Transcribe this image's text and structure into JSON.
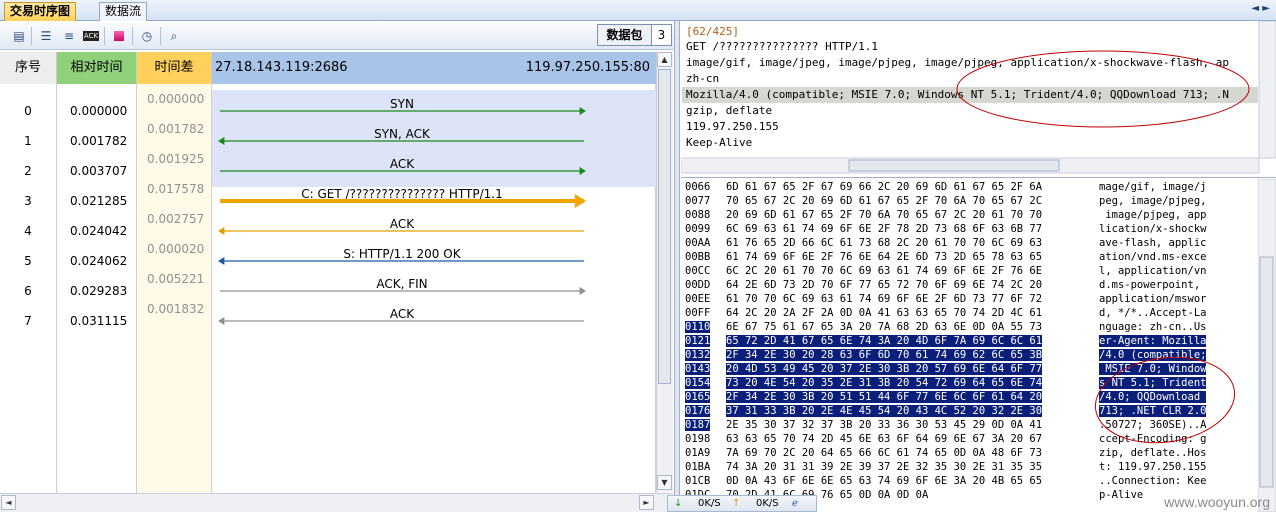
{
  "tabs": [
    {
      "label": "交易时序图"
    },
    {
      "label": "数据流"
    }
  ],
  "nav": {
    "left": "◄",
    "right": "►"
  },
  "toolbar": {
    "packet_label": "数据包",
    "packet_count": "3"
  },
  "columns": {
    "seq": "序号",
    "reltime": "相对时间",
    "delta": "时间差",
    "src": "27.18.143.119:2686",
    "dst": "119.97.250.155:80"
  },
  "rows": [
    {
      "seq": "0",
      "rel": "0.000000",
      "delta": "0.000000",
      "label": "SYN",
      "dir": "right",
      "color": "#1d8a1d"
    },
    {
      "seq": "1",
      "rel": "0.001782",
      "delta": "0.001782",
      "label": "SYN, ACK",
      "dir": "left",
      "color": "#1d8a1d"
    },
    {
      "seq": "2",
      "rel": "0.003707",
      "delta": "0.001925",
      "label": "ACK",
      "dir": "right",
      "color": "#1d8a1d"
    },
    {
      "seq": "3",
      "rel": "0.021285",
      "delta": "0.017578",
      "label": "C: GET /??????????????? HTTP/1.1",
      "dir": "right",
      "color": "#f0a500"
    },
    {
      "seq": "4",
      "rel": "0.024042",
      "delta": "0.002757",
      "label": "ACK",
      "dir": "left",
      "color": "#e0a000"
    },
    {
      "seq": "5",
      "rel": "0.024062",
      "delta": "0.000020",
      "label": "S: HTTP/1.1 200 OK",
      "dir": "left",
      "color": "#1f5aa8"
    },
    {
      "seq": "6",
      "rel": "0.029283",
      "delta": "0.005221",
      "label": "ACK, FIN",
      "dir": "right",
      "color": "#909090"
    },
    {
      "seq": "7",
      "rel": "0.031115",
      "delta": "0.001832",
      "label": "ACK",
      "dir": "left",
      "color": "#909090"
    }
  ],
  "request": {
    "counter": "[62/425]",
    "lines": [
      "GET /??????????????? HTTP/1.1",
      "image/gif, image/jpeg, image/pjpeg, image/pjpeg, application/x-shockwave-flash, ap",
      "zh-cn",
      "Mozilla/4.0 (compatible; MSIE 7.0; Windows NT 5.1; Trident/4.0; QQDownload 713; .N",
      "gzip, deflate",
      "119.97.250.155",
      "Keep-Alive"
    ]
  },
  "hex": [
    {
      "off": "0066",
      "bytes": "6D 61 67 65 2F 67 69 66 2C 20 69 6D 61 67 65 2F 6A",
      "ascii": "mage/gif, image/j"
    },
    {
      "off": "0077",
      "bytes": "70 65 67 2C 20 69 6D 61 67 65 2F 70 6A 70 65 67 2C",
      "ascii": "peg, image/pjpeg,"
    },
    {
      "off": "0088",
      "bytes": "20 69 6D 61 67 65 2F 70 6A 70 65 67 2C 20 61 70 70",
      "ascii": " image/pjpeg, app"
    },
    {
      "off": "0099",
      "bytes": "6C 69 63 61 74 69 6F 6E 2F 78 2D 73 68 6F 63 6B 77",
      "ascii": "lication/x-shockw"
    },
    {
      "off": "00AA",
      "bytes": "61 76 65 2D 66 6C 61 73 68 2C 20 61 70 70 6C 69 63",
      "ascii": "ave-flash, applic"
    },
    {
      "off": "00BB",
      "bytes": "61 74 69 6F 6E 2F 76 6E 64 2E 6D 73 2D 65 78 63 65",
      "ascii": "ation/vnd.ms-exce"
    },
    {
      "off": "00CC",
      "bytes": "6C 2C 20 61 70 70 6C 69 63 61 74 69 6F 6E 2F 76 6E",
      "ascii": "l, application/vn"
    },
    {
      "off": "00DD",
      "bytes": "64 2E 6D 73 2D 70 6F 77 65 72 70 6F 69 6E 74 2C 20",
      "ascii": "d.ms-powerpoint, "
    },
    {
      "off": "00EE",
      "bytes": "61 70 70 6C 69 63 61 74 69 6F 6E 2F 6D 73 77 6F 72",
      "ascii": "application/mswor"
    },
    {
      "off": "00FF",
      "bytes": "64 2C 20 2A 2F 2A 0D 0A 41 63 63 65 70 74 2D 4C 61",
      "ascii": "d, */*..Accept-La"
    },
    {
      "off": "0110",
      "bytes": "6E 67 75 61 67 65 3A 20 7A 68 2D 63 6E 0D 0A 55 73",
      "ascii": "nguage: zh-cn..Us"
    },
    {
      "off": "0121",
      "bytes": "65 72 2D 41 67 65 6E 74 3A 20 4D 6F 7A 69 6C 6C 61",
      "ascii": "er-Agent: Mozilla"
    },
    {
      "off": "0132",
      "bytes": "2F 34 2E 30 20 28 63 6F 6D 70 61 74 69 62 6C 65 3B",
      "ascii": "/4.0 (compatible;"
    },
    {
      "off": "0143",
      "bytes": "20 4D 53 49 45 20 37 2E 30 3B 20 57 69 6E 64 6F 77",
      "ascii": " MSIE 7.0; Window"
    },
    {
      "off": "0154",
      "bytes": "73 20 4E 54 20 35 2E 31 3B 20 54 72 69 64 65 6E 74",
      "ascii": "s NT 5.1; Trident"
    },
    {
      "off": "0165",
      "bytes": "2F 34 2E 30 3B 20 51 51 44 6F 77 6E 6C 6F 61 64 20",
      "ascii": "/4.0; QQDownload "
    },
    {
      "off": "0176",
      "bytes": "37 31 33 3B 20 2E 4E 45 54 20 43 4C 52 20 32 2E 30",
      "ascii": "713; .NET CLR 2.0"
    },
    {
      "off": "0187",
      "bytes": "2E 35 30 37 32 37 3B 20 33 36 30 53 45 29 0D 0A 41",
      "ascii": ".50727; 360SE)..A"
    },
    {
      "off": "0198",
      "bytes": "63 63 65 70 74 2D 45 6E 63 6F 64 69 6E 67 3A 20 67",
      "ascii": "ccept-Encoding: g"
    },
    {
      "off": "01A9",
      "bytes": "7A 69 70 2C 20 64 65 66 6C 61 74 65 0D 0A 48 6F 73",
      "ascii": "zip, deflate..Hos"
    },
    {
      "off": "01BA",
      "bytes": "74 3A 20 31 31 39 2E 39 37 2E 32 35 30 2E 31 35 35",
      "ascii": "t: 119.97.250.155"
    },
    {
      "off": "01CB",
      "bytes": "0D 0A 43 6F 6E 6E 65 63 74 69 6F 6E 3A 20 4B 65 65",
      "ascii": "..Connection: Kee"
    },
    {
      "off": "01DC",
      "bytes": "70 2D 41 6C 69 76 65 0D 0A 0D 0A",
      "ascii": "p-Alive"
    }
  ],
  "status": {
    "down": "0K/S",
    "up": "0K/S"
  },
  "watermark": "www.wooyun.org",
  "colors": {
    "accent": "#ffd15c",
    "selection": "#0a1f7a",
    "highlight_annot": "#c00000"
  }
}
